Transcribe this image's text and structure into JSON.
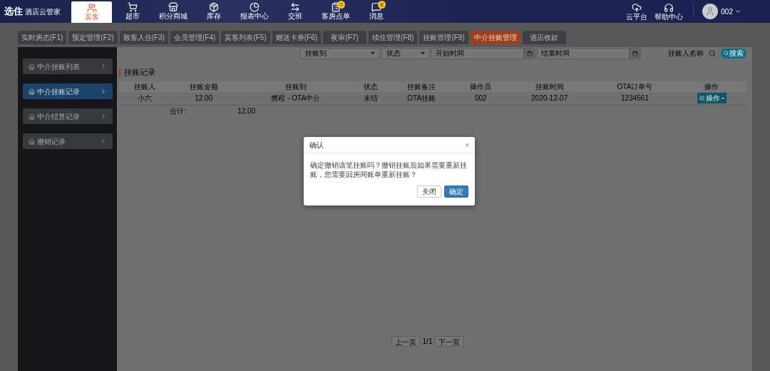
{
  "header": {
    "logo": "选住",
    "brand": "酒店云管家",
    "nav": [
      {
        "label": "宾客",
        "selected": true
      },
      {
        "label": "超市",
        "selected": false
      },
      {
        "label": "积分商城",
        "selected": false
      },
      {
        "label": "库存",
        "selected": false
      },
      {
        "label": "报表中心",
        "selected": false
      },
      {
        "label": "交班",
        "selected": false
      },
      {
        "label": "客房点单",
        "selected": false,
        "badge": "0"
      },
      {
        "label": "消息",
        "selected": false,
        "badge": "8"
      }
    ],
    "tools": [
      {
        "label": "云平台"
      },
      {
        "label": "帮助中心"
      }
    ],
    "user": "002"
  },
  "tabs": [
    {
      "label": "实时房态(F1)",
      "selected": false
    },
    {
      "label": "预定管理(F2)",
      "selected": false
    },
    {
      "label": "散客入住(F3)",
      "selected": false
    },
    {
      "label": "会员管理(F4)",
      "selected": false
    },
    {
      "label": "宾客列表(F5)",
      "selected": false
    },
    {
      "label": "赠送卡券(F6)",
      "selected": false
    },
    {
      "label": "夜审(F7)",
      "selected": false
    },
    {
      "label": "续住管理(F8)",
      "selected": false
    },
    {
      "label": "挂账管理(F9)",
      "selected": false
    },
    {
      "label": "中介挂账管理",
      "selected": true
    },
    {
      "label": "酒店收款",
      "selected": false
    }
  ],
  "sidebar": [
    {
      "label": "中介挂账列表",
      "selected": false
    },
    {
      "label": "中介挂账记录",
      "selected": true
    },
    {
      "label": "中介结算记录",
      "selected": false
    },
    {
      "label": "撤销记录",
      "selected": false
    }
  ],
  "filters": {
    "payee": "挂账到",
    "status": "状态",
    "start_placeholder": "开始时间",
    "end_placeholder": "结束时间",
    "name_placeholder": "挂账人名称",
    "search": "搜索"
  },
  "section_title": "挂账记录",
  "table": {
    "columns": [
      "挂账人",
      "挂账金额",
      "挂账到",
      "状态",
      "挂账备注",
      "操作员",
      "挂账时间",
      "OTA订单号",
      "操作"
    ],
    "rows": [
      {
        "cells": [
          "小六",
          "12.00",
          "携程 - OTA中介",
          "未结",
          "OTA挂账",
          "002",
          "2020-12-07",
          "1234561"
        ],
        "action": "操作"
      }
    ],
    "total": {
      "label": "合计:",
      "value": "12.00"
    }
  },
  "pagination": {
    "prev": "上一页",
    "page": "1/1",
    "next": "下一页"
  },
  "dialog": {
    "title": "确认",
    "close": "×",
    "message": "确定撤销该笔挂账吗？撤销挂账后如果需要重新挂账，您需要回房间账单重新挂账？",
    "buttons": [
      {
        "label": "关闭",
        "kind": "default"
      },
      {
        "label": "确定",
        "kind": "primary"
      }
    ]
  }
}
